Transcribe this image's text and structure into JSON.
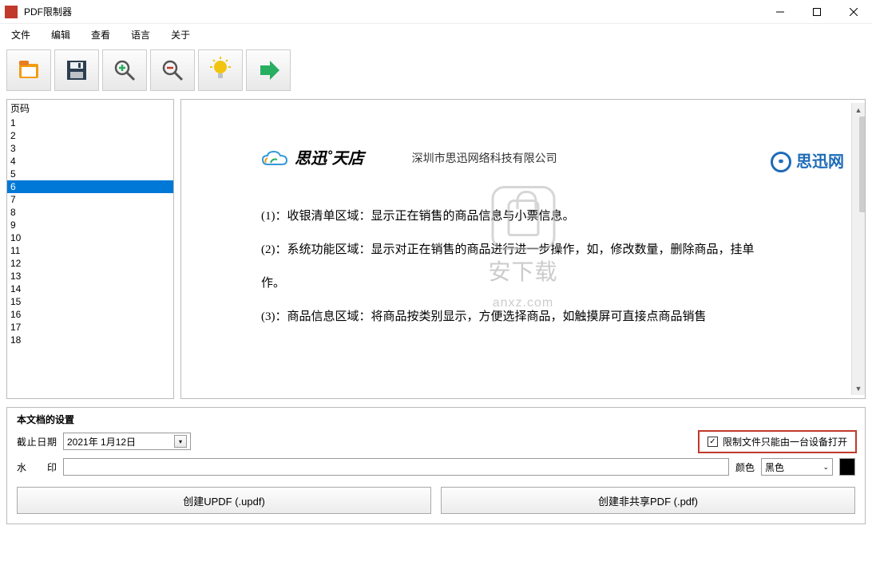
{
  "window": {
    "title": "PDF限制器"
  },
  "menu": {
    "file": "文件",
    "edit": "编辑",
    "view": "查看",
    "language": "语言",
    "about": "关于"
  },
  "sidebar": {
    "header": "页码",
    "pages": [
      "1",
      "2",
      "3",
      "4",
      "5",
      "6",
      "7",
      "8",
      "9",
      "10",
      "11",
      "12",
      "13",
      "14",
      "15",
      "16",
      "17",
      "18"
    ],
    "selected": "6"
  },
  "document": {
    "brand": "思迅˚天店",
    "company": "深圳市思迅网络科技有限公司",
    "brand_right": "思迅网",
    "line1": "(1)：收银清单区域：显示正在销售的商品信息与小票信息。",
    "line2": "(2)：系统功能区域：显示对正在销售的商品进行进一步操作，如，修改数量，删除商品，挂单",
    "line2b": "作。",
    "line3": "(3)：商品信息区域：将商品按类别显示，方便选择商品，如触摸屏可直接点商品销售"
  },
  "watermark_overlay": {
    "text_main": "安下载",
    "text_sub": "anxz.com"
  },
  "settings": {
    "title": "本文档的设置",
    "deadline_label": "截止日期",
    "deadline_value": "2021年  1月12日",
    "restrict_checked": true,
    "restrict_label": "限制文件只能由一台设备打开",
    "watermark_label": "水印",
    "watermark_value": "",
    "color_label": "颜色",
    "color_value": "黑色",
    "btn_updf": "创建UPDF (.updf)",
    "btn_pdf": "创建非共享PDF (.pdf)"
  }
}
